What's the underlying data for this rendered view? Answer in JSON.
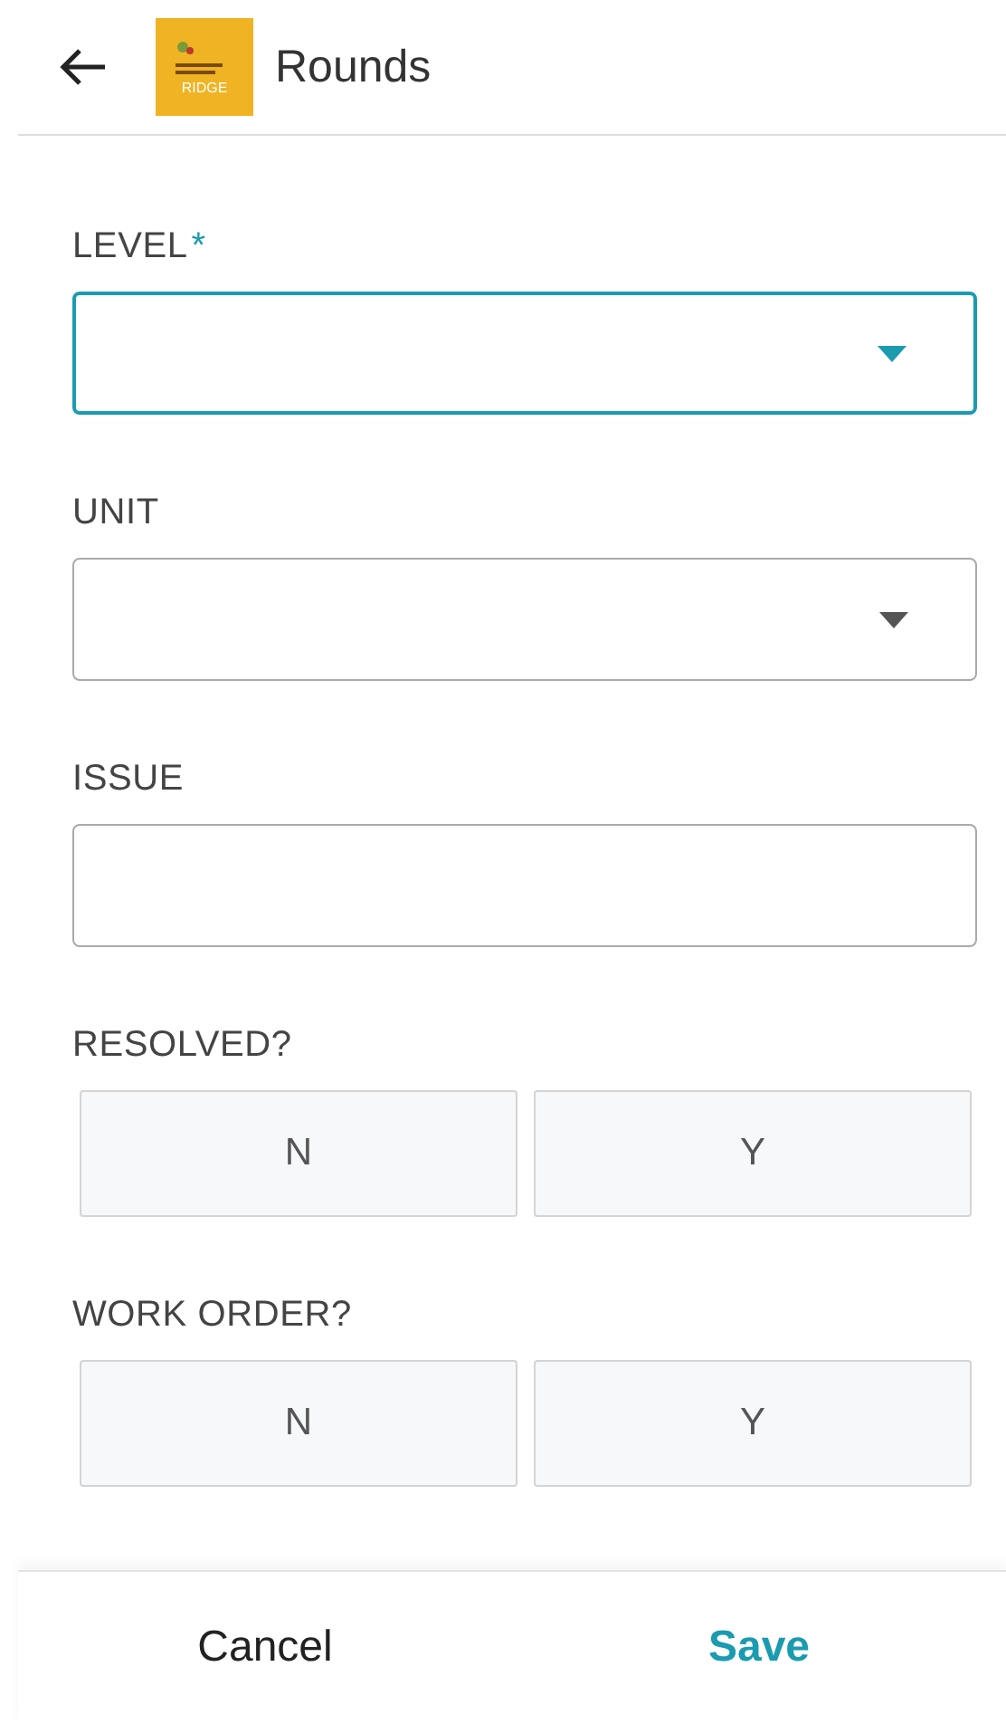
{
  "header": {
    "title": "Rounds",
    "logo_text": "RIDGE"
  },
  "fields": [
    {
      "kind": "select",
      "label": "LEVEL",
      "required_mark": "*",
      "focused": true
    },
    {
      "kind": "select",
      "label": "UNIT",
      "focused": false
    },
    {
      "kind": "text",
      "label": "ISSUE",
      "focused": false
    },
    {
      "kind": "choice",
      "label": "RESOLVED?",
      "options": [
        {
          "label": "N",
          "selected": false
        },
        {
          "label": "Y",
          "selected": false
        }
      ]
    },
    {
      "kind": "choice",
      "label": "WORK ORDER?",
      "options": [
        {
          "label": "N",
          "selected": false
        },
        {
          "label": "Y",
          "selected": false
        }
      ]
    }
  ],
  "footer": {
    "cancel": "Cancel",
    "save": "Save"
  }
}
